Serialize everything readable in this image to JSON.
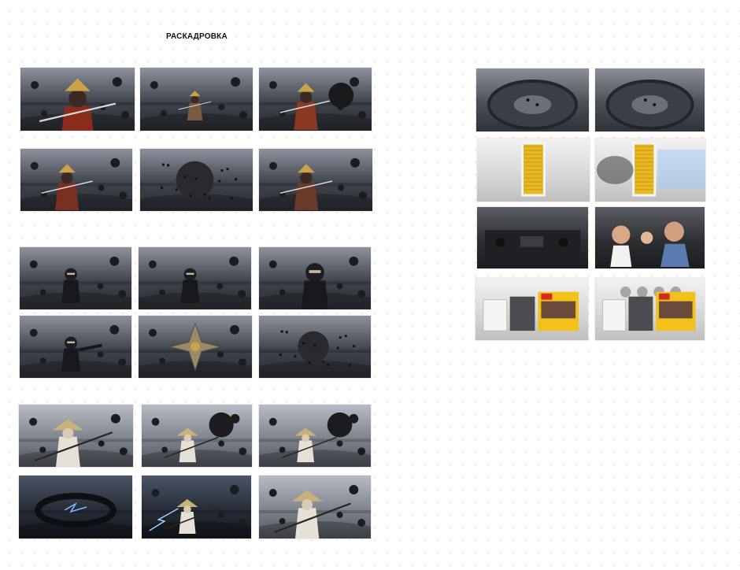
{
  "board": {
    "title": "РАСКАДРОВКА"
  },
  "frames": [
    {
      "id": "samurai-portrait",
      "kind": "dark",
      "subject": "samurai",
      "accent": "#8a2b1c"
    },
    {
      "id": "samurai-virus-field",
      "kind": "dark",
      "subject": "samurai-small",
      "accent": "#7a5a40"
    },
    {
      "id": "samurai-strikes-virus",
      "kind": "dark",
      "subject": "samurai-virus",
      "accent": "#8a3a22"
    },
    {
      "id": "samurai-leap",
      "kind": "dark",
      "subject": "samurai-jump",
      "accent": "#7a3020"
    },
    {
      "id": "virus-closeup",
      "kind": "dark",
      "subject": "orb",
      "accent": "#2a2a2a"
    },
    {
      "id": "samurai-stance",
      "kind": "dark",
      "subject": "samurai-wide",
      "accent": "#6a3a28"
    },
    {
      "id": "ninja-kick",
      "kind": "dark",
      "subject": "ninja-jump",
      "accent": "#1c1d22"
    },
    {
      "id": "ninja-landing",
      "kind": "dark",
      "subject": "ninja-crouch",
      "accent": "#1c1d22"
    },
    {
      "id": "ninja-closeup",
      "kind": "dark",
      "subject": "ninja-face",
      "accent": "#1c1d22"
    },
    {
      "id": "ninja-throw",
      "kind": "dark",
      "subject": "ninja-throw",
      "accent": "#1c1d22"
    },
    {
      "id": "shuriken-js",
      "kind": "dark",
      "subject": "shuriken",
      "accent": "#b79a62"
    },
    {
      "id": "virus-explodes",
      "kind": "dark",
      "subject": "orb-burst",
      "accent": "#3a3a3a"
    },
    {
      "id": "monk-staff",
      "kind": "grey",
      "subject": "monk-hat",
      "accent": "#d8d2c4"
    },
    {
      "id": "monk-smoke",
      "kind": "grey",
      "subject": "monk-smoke",
      "accent": "#d8d2c4"
    },
    {
      "id": "monk-strike",
      "kind": "grey",
      "subject": "monk-strike",
      "accent": "#d8d2c4"
    },
    {
      "id": "lightning-ring",
      "kind": "night",
      "subject": "ring",
      "accent": "#7fb8ff"
    },
    {
      "id": "monk-lightning",
      "kind": "night",
      "subject": "monk-bolt",
      "accent": "#9fd0ff"
    },
    {
      "id": "monk-closeup",
      "kind": "grey",
      "subject": "monk-face",
      "accent": "#d8d2c4"
    },
    {
      "id": "arena-top-1",
      "kind": "arena",
      "subject": "arena",
      "accent": "#9aa0a8"
    },
    {
      "id": "arena-top-2",
      "kind": "arena",
      "subject": "arena2",
      "accent": "#9aa0a8"
    },
    {
      "id": "filter-product",
      "kind": "studio",
      "subject": "filter",
      "accent": "#e8b820"
    },
    {
      "id": "filter-airflow",
      "kind": "studio",
      "subject": "filter-air",
      "accent": "#e8b820"
    },
    {
      "id": "car-interior",
      "kind": "car",
      "subject": "dashboard",
      "accent": "#2a2c30"
    },
    {
      "id": "happy-family",
      "kind": "car",
      "subject": "family",
      "accent": "#c89a78"
    },
    {
      "id": "packshot",
      "kind": "studio",
      "subject": "pack",
      "accent": "#f2c21a"
    },
    {
      "id": "packshot-ninjas",
      "kind": "studio",
      "subject": "pack-ninja",
      "accent": "#f2c21a"
    }
  ]
}
